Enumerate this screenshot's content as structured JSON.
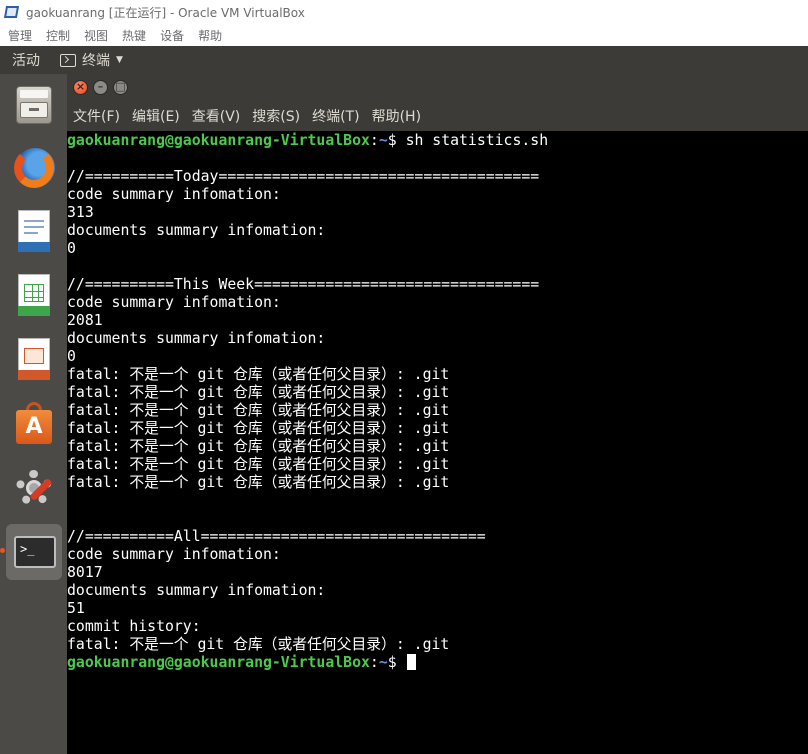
{
  "vbox": {
    "title": "gaokuanrang [正在运行] - Oracle VM VirtualBox",
    "menu": [
      "管理",
      "控制",
      "视图",
      "热键",
      "设备",
      "帮助"
    ]
  },
  "panel": {
    "activities": "活动",
    "app_name": "终端"
  },
  "dock": {
    "items": [
      {
        "name": "files",
        "icon": "file-cabinet-icon"
      },
      {
        "name": "firefox",
        "icon": "firefox-icon"
      },
      {
        "name": "writer",
        "icon": "libreoffice-writer-icon"
      },
      {
        "name": "calc",
        "icon": "libreoffice-calc-icon"
      },
      {
        "name": "impress",
        "icon": "libreoffice-impress-icon"
      },
      {
        "name": "software",
        "icon": "software-center-icon",
        "letter": "A"
      },
      {
        "name": "settings",
        "icon": "system-settings-icon"
      },
      {
        "name": "terminal",
        "icon": "terminal-icon",
        "active": true,
        "prompt": ">_"
      }
    ]
  },
  "terminal": {
    "menu": [
      "文件(F)",
      "编辑(E)",
      "查看(V)",
      "搜索(S)",
      "终端(T)",
      "帮助(H)"
    ],
    "user_host": "gaokuanrang@gaokuanrang-VirtualBox",
    "path": "~",
    "prompt_end": "$",
    "command": " sh statistics.sh",
    "lines": [
      "",
      "//==========Today====================================",
      "code summary infomation:",
      "313",
      "documents summary infomation:",
      "0",
      "",
      "//==========This Week================================",
      "code summary infomation:",
      "2081",
      "documents summary infomation:",
      "0",
      "fatal: 不是一个 git 仓库（或者任何父目录）: .git",
      "fatal: 不是一个 git 仓库（或者任何父目录）: .git",
      "fatal: 不是一个 git 仓库（或者任何父目录）: .git",
      "fatal: 不是一个 git 仓库（或者任何父目录）: .git",
      "fatal: 不是一个 git 仓库（或者任何父目录）: .git",
      "fatal: 不是一个 git 仓库（或者任何父目录）: .git",
      "fatal: 不是一个 git 仓库（或者任何父目录）: .git",
      "",
      "",
      "//==========All================================",
      "code summary infomation:",
      "8017",
      "documents summary infomation:",
      "51",
      "commit history:",
      "fatal: 不是一个 git 仓库（或者任何父目录）: .git"
    ]
  },
  "colors": {
    "prompt_user": "#4ec94e",
    "prompt_path": "#6a8fd8",
    "panel_bg": "#3c3b37",
    "dock_bg": "#4b4a46",
    "close_button": "#df4a1c"
  }
}
